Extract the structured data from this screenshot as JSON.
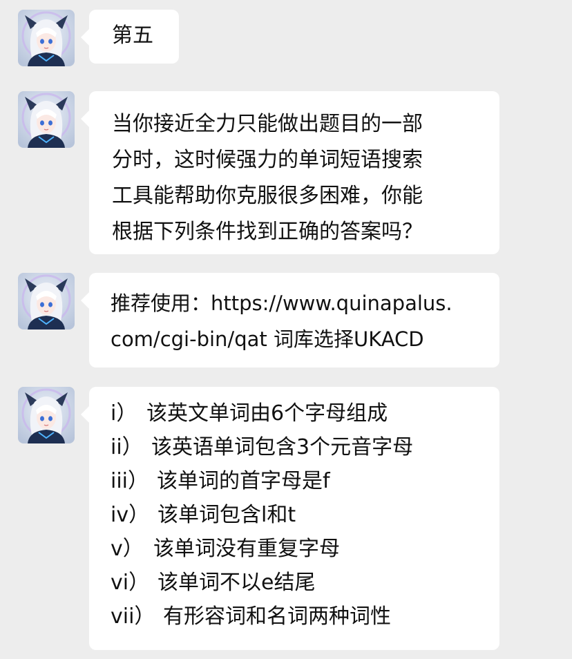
{
  "messages": [
    {
      "sender": "assistant",
      "lines": [
        "第五"
      ]
    },
    {
      "sender": "assistant",
      "lines": [
        "当你接近全力只能做出题目的一部",
        "分时，这时候强力的单词短语搜索",
        "工具能帮助你克服很多困难，你能",
        "根据下列条件找到正确的答案吗？"
      ]
    },
    {
      "sender": "assistant",
      "lines": [
        "推荐使用：https://www.quinapalus.",
        "com/cgi-bin/qat 词库选择UKACD"
      ]
    },
    {
      "sender": "assistant",
      "items": [
        {
          "num": "i）",
          "text": "该英文单词由6个字母组成"
        },
        {
          "num": "ii）",
          "text": "该英语单词包含3个元音字母"
        },
        {
          "num": "iii）",
          "text": "该单词的首字母是f"
        },
        {
          "num": "iv）",
          "text": "该单词包含l和t"
        },
        {
          "num": "v）",
          "text": "该单词没有重复字母"
        },
        {
          "num": "vi）",
          "text": "该单词不以e结尾"
        },
        {
          "num": "vii）",
          "text": "有形容词和名词两种词性"
        }
      ]
    }
  ],
  "colors": {
    "background": "#ededed",
    "bubble": "#ffffff",
    "text": "#111111"
  },
  "icons": {
    "avatar": "anime-girl-avatar-icon"
  }
}
